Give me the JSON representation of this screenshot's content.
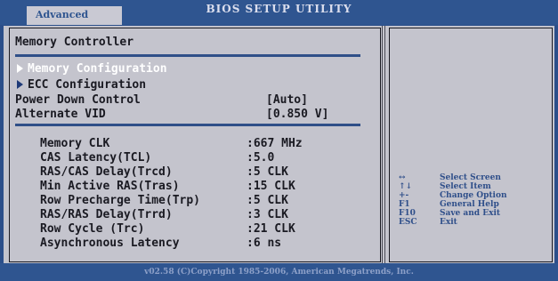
{
  "header": {
    "tab_label": "Advanced",
    "title": "BIOS SETUP UTILITY"
  },
  "main": {
    "section_title": "Memory Controller",
    "menu_items": [
      {
        "label": "Memory Configuration",
        "selected": true
      },
      {
        "label": "ECC Configuration",
        "selected": false
      }
    ],
    "settings": [
      {
        "label": "Power Down Control",
        "value": "[Auto]"
      },
      {
        "label": "Alternate VID",
        "value": "[0.850 V]"
      }
    ],
    "info": [
      {
        "label": "Memory CLK",
        "value": ":667 MHz"
      },
      {
        "label": "CAS Latency(TCL)",
        "value": ":5.0"
      },
      {
        "label": "RAS/CAS Delay(Trcd)",
        "value": ":5 CLK"
      },
      {
        "label": "Min Active RAS(Tras)",
        "value": ":15 CLK"
      },
      {
        "label": "Row Precharge Time(Trp)",
        "value": ":5 CLK"
      },
      {
        "label": "RAS/RAS Delay(Trrd)",
        "value": ":3 CLK"
      },
      {
        "label": "Row Cycle (Trc)",
        "value": ":21 CLK"
      },
      {
        "label": "Asynchronous Latency",
        "value": ":6 ns"
      }
    ]
  },
  "help": [
    {
      "key": "↔",
      "desc": "Select Screen"
    },
    {
      "key": "↑↓",
      "desc": "Select Item"
    },
    {
      "key": "+-",
      "desc": "Change Option"
    },
    {
      "key": "F1",
      "desc": "General Help"
    },
    {
      "key": "F10",
      "desc": "Save and Exit"
    },
    {
      "key": "ESC",
      "desc": "Exit"
    }
  ],
  "footer": {
    "copyright": "v02.58 (C)Copyright 1985-2006, American Megatrends, Inc."
  }
}
